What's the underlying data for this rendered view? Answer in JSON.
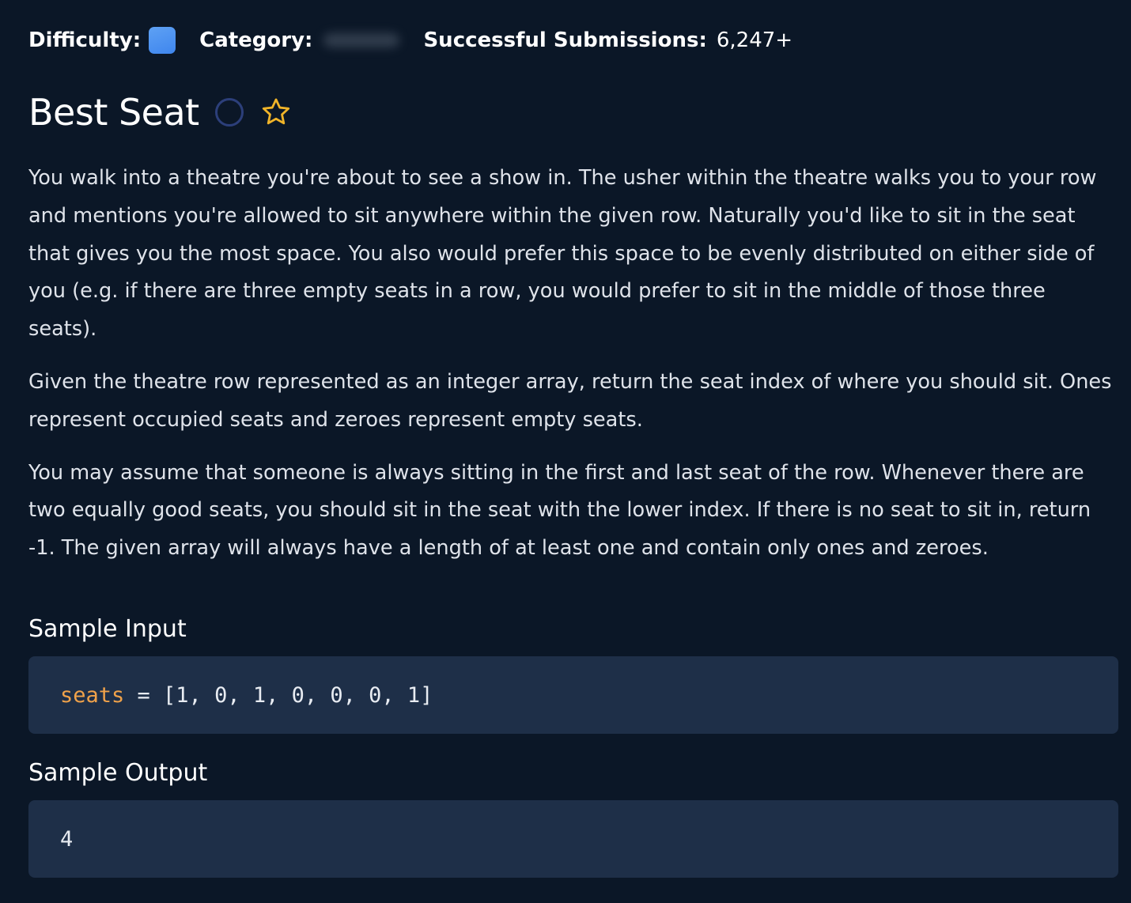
{
  "meta": {
    "difficulty_label": "Difficulty:",
    "difficulty_color": "#4a8ff0",
    "category_label": "Category:",
    "submissions_label": "Successful Submissions:",
    "submissions_value": "6,247+"
  },
  "title": "Best Seat",
  "icons": {
    "complete": "circle-outline-icon",
    "favorite": "star-outline-icon",
    "star_color": "#f0b429"
  },
  "description": [
    "You walk into a theatre you're about to see a show in. The usher within the theatre walks you to your row and mentions you're allowed to sit anywhere within the given row. Naturally you'd like to sit in the seat that gives you the most space. You also would prefer this space to be evenly distributed on either side of you (e.g. if there are three empty seats in a row, you would prefer to sit in the middle of those three seats).",
    "Given the theatre row represented as an integer array, return the seat index of where you should sit. Ones represent occupied seats and zeroes represent empty seats.",
    "You may assume that someone is always sitting in the first and last seat of the row. Whenever there are two equally good seats, you should sit in the seat with the lower index. If there is no seat to sit in, return -1. The given array will always have a length of at least one and contain only ones and zeroes."
  ],
  "sample_input": {
    "heading": "Sample Input",
    "var_name": "seats",
    "rest": " = [1, 0, 1, 0, 0, 0, 1]"
  },
  "sample_output": {
    "heading": "Sample Output",
    "value": "4"
  }
}
